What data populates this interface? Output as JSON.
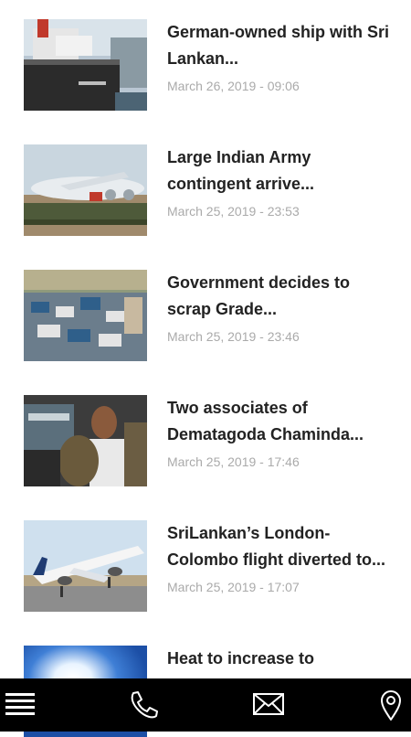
{
  "articles": [
    {
      "title": "German-owned ship with Sri Lankan...",
      "date": "March 26, 2019 - 09:06",
      "thumb": "ship-photo"
    },
    {
      "title": "Large Indian Army contingent arrive...",
      "date": "March 25, 2019 - 23:53",
      "thumb": "aircraft-troops-photo"
    },
    {
      "title": "Government decides to scrap Grade...",
      "date": "March 25, 2019 - 23:46",
      "thumb": "exam-hall-photo"
    },
    {
      "title": "Two associates of Dematagoda Chaminda...",
      "date": "March 25, 2019 - 17:46",
      "thumb": "police-arrest-photo"
    },
    {
      "title": "SriLankan’s London-Colombo flight diverted to...",
      "date": "March 25, 2019 - 17:07",
      "thumb": "airliner-photo"
    },
    {
      "title": "Heat to increase to “Extreme...",
      "date": "",
      "thumb": "sun-sky-photo"
    }
  ],
  "bottom_bar": {
    "icons": [
      "menu-icon",
      "phone-icon",
      "mail-icon",
      "location-pin-icon"
    ],
    "background": "#000000",
    "icon_color": "#ffffff"
  },
  "colors": {
    "title": "#222222",
    "date": "#aaaaaa",
    "background": "#ffffff"
  }
}
